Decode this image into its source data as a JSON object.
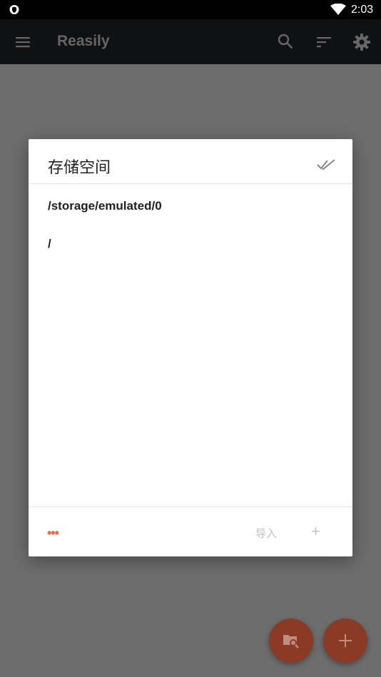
{
  "status_bar": {
    "time": "2:03"
  },
  "app_bar": {
    "title": "Reasily"
  },
  "dialog": {
    "title": "存储空间",
    "paths": [
      "/storage/emulated/0",
      "/"
    ],
    "footer": {
      "more_label": "•••",
      "import_label": "导入",
      "add_label": "+"
    }
  },
  "colors": {
    "accent": "#e36b4d",
    "app_bar": "#0f1113",
    "scrim": "#6d6d6d"
  }
}
